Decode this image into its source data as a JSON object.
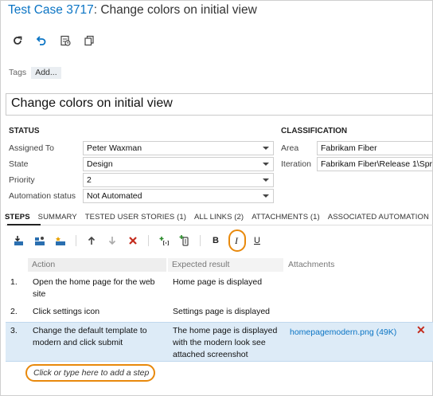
{
  "header": {
    "work_item": "Test Case 3717",
    "separator": ":",
    "title": "Change colors on initial view"
  },
  "toolbar": {
    "icons": [
      "refresh-icon",
      "undo-icon",
      "history-icon",
      "copy-icon"
    ]
  },
  "tags": {
    "label": "Tags",
    "add_label": "Add..."
  },
  "title_field": {
    "value": "Change colors on initial view"
  },
  "status": {
    "heading": "STATUS",
    "fields": [
      {
        "label": "Assigned To",
        "value": "Peter Waxman"
      },
      {
        "label": "State",
        "value": "Design"
      },
      {
        "label": "Priority",
        "value": "2"
      },
      {
        "label": "Automation status",
        "value": "Not Automated"
      }
    ]
  },
  "classification": {
    "heading": "CLASSIFICATION",
    "fields": [
      {
        "label": "Area",
        "value": "Fabrikam Fiber"
      },
      {
        "label": "Iteration",
        "value": "Fabrikam Fiber\\Release 1\\Spr"
      }
    ]
  },
  "tabs": [
    "STEPS",
    "SUMMARY",
    "TESTED USER STORIES (1)",
    "ALL LINKS (2)",
    "ATTACHMENTS (1)",
    "ASSOCIATED AUTOMATION"
  ],
  "steps_toolbar": {
    "icons": [
      "insert-step-icon",
      "insert-shared-steps-icon",
      "create-shared-steps-icon",
      "move-up-icon",
      "move-down-icon",
      "delete-step-icon",
      "insert-parameter-icon",
      "attach-file-icon",
      "bold-icon",
      "italic-icon",
      "underline-icon"
    ],
    "bold": "B",
    "italic": "I",
    "underline": "U"
  },
  "grid": {
    "headers": {
      "action": "Action",
      "expected": "Expected result",
      "attachments": "Attachments"
    },
    "rows": [
      {
        "num": "1.",
        "action": "Open the home page for the web site",
        "expected": "Home page is displayed",
        "attachment": ""
      },
      {
        "num": "2.",
        "action": "Click settings icon",
        "expected": "Settings page is displayed",
        "attachment": ""
      },
      {
        "num": "3.",
        "action": "Change the default template to modern and click submit",
        "expected": "The home page is displayed with the modern look see attached screenshot",
        "attachment": "homepagemodern.png (49K)",
        "delete": "✕"
      }
    ],
    "add_step": "Click or type here to add a step"
  },
  "colors": {
    "accent": "#0a74c4",
    "highlight": "#e8890c",
    "selected_row": "#ddebf7",
    "delete": "#c42b1c"
  }
}
